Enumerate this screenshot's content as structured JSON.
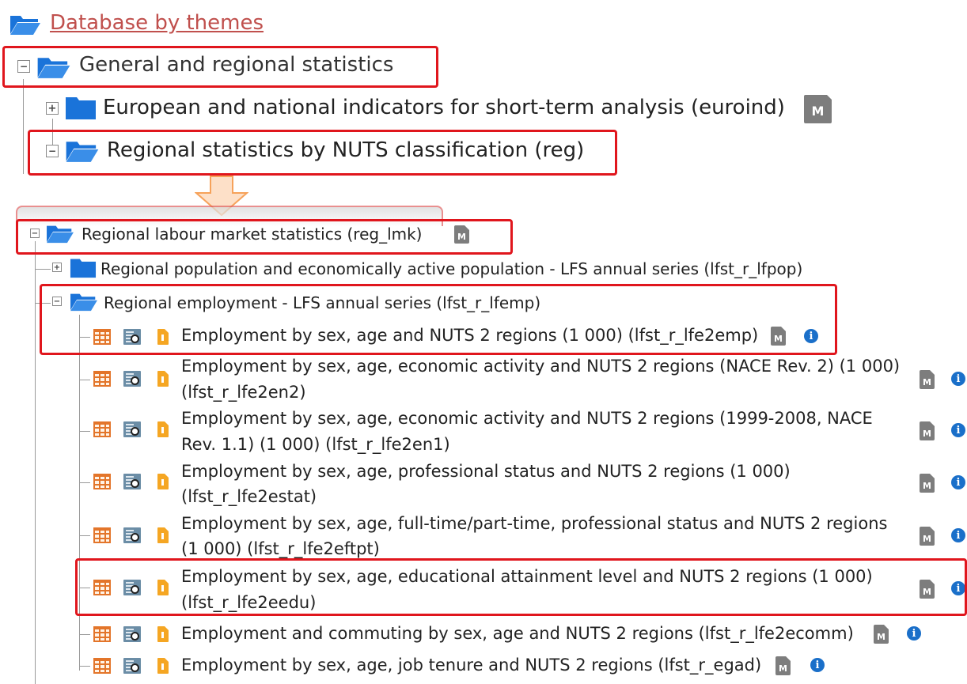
{
  "root": {
    "label": "Database by themes"
  },
  "tree": {
    "general": {
      "label": "General and regional statistics"
    },
    "euroind": {
      "label": "European and national indicators for short-term analysis (euroind)"
    },
    "reg": {
      "label": "Regional statistics by NUTS classification (reg)"
    },
    "reg_lmk": {
      "label": "Regional labour market statistics (reg_lmk)"
    },
    "lfpop": {
      "label": "Regional population and economically active population - LFS annual series (lfst_r_lfpop)"
    },
    "lfemp": {
      "label": "Regional employment - LFS annual series (lfst_r_lfemp)"
    }
  },
  "datasets": [
    {
      "line1": "Employment by sex, age and NUTS 2 regions (1 000) (lfst_r_lfe2emp)",
      "line2": ""
    },
    {
      "line1": "Employment by sex, age, economic activity and NUTS 2 regions (NACE Rev. 2) (1 000)",
      "line2": "(lfst_r_lfe2en2)"
    },
    {
      "line1": "Employment by sex, age, economic activity and NUTS 2 regions (1999-2008, NACE",
      "line2": "Rev. 1.1) (1 000) (lfst_r_lfe2en1)"
    },
    {
      "line1": "Employment by sex, age, professional status and NUTS 2 regions (1 000)",
      "line2": "(lfst_r_lfe2estat)"
    },
    {
      "line1": "Employment by sex, age, full-time/part-time, professional status and NUTS 2 regions",
      "line2": "(1 000) (lfst_r_lfe2eftpt)"
    },
    {
      "line1": "Employment by sex, age, educational attainment level and NUTS 2 regions (1 000)",
      "line2": "(lfst_r_lfe2eedu)"
    },
    {
      "line1": "Employment and commuting by sex, age and NUTS 2 regions (lfst_r_lfe2ecomm)",
      "line2": ""
    },
    {
      "line1": "Employment by sex, age, job tenure and NUTS 2 regions (lfst_r_egad)",
      "line2": ""
    }
  ],
  "icons": {
    "metadata": "M",
    "info": "i",
    "expand": "+",
    "collapse": "−"
  },
  "colors": {
    "highlight": "#e0161d",
    "folder": "#1a73d9",
    "link": "#c0504d",
    "arrow": "#f6a25a"
  }
}
